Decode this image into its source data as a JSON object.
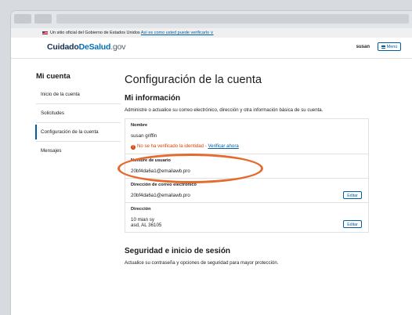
{
  "gov_banner": {
    "text": "Un sitio oficial del Gobierno de Estados Unidos",
    "link": "Así es como usted puede verificarlo ∨"
  },
  "header": {
    "logo_part1": "Cuidado",
    "logo_part2": "DeSalud",
    "logo_part3": ".gov",
    "user": "susan",
    "menu_label": "Menú"
  },
  "sidebar": {
    "title": "Mi cuenta",
    "items": [
      {
        "label": "Inicio de la cuenta"
      },
      {
        "label": "Solicitudes"
      },
      {
        "label": "Configuración de la cuenta"
      },
      {
        "label": "Mensajes"
      }
    ]
  },
  "main": {
    "title": "Configuración de la cuenta",
    "section_title": "Mi información",
    "section_desc": "Administre o actualice su correo electrónico, dirección y otra información básica de su cuenta.",
    "name_label": "Nombre",
    "name_value": "susan griffin",
    "warning_text": "No se ha verificado la identidad - ",
    "warning_link": "Verificar ahora",
    "username_label": "Nombre de usuario",
    "username_value": "20bf4da6a1@emailawb.pro",
    "email_label": "Dirección de correo electrónico",
    "email_value": "20bf4da6a1@emailawb.pro",
    "address_label": "Dirección",
    "address_line1": "10 mian sy",
    "address_line2": "asd, AL 36105",
    "edit_label": "Editar",
    "security_title": "Seguridad e inicio de sesión",
    "security_desc": "Actualice su contraseña y opciones de seguridad para mayor protección."
  },
  "colors": {
    "primary": "#005ea2",
    "warning": "#d54309",
    "highlight_ring": "#e56a2d"
  }
}
